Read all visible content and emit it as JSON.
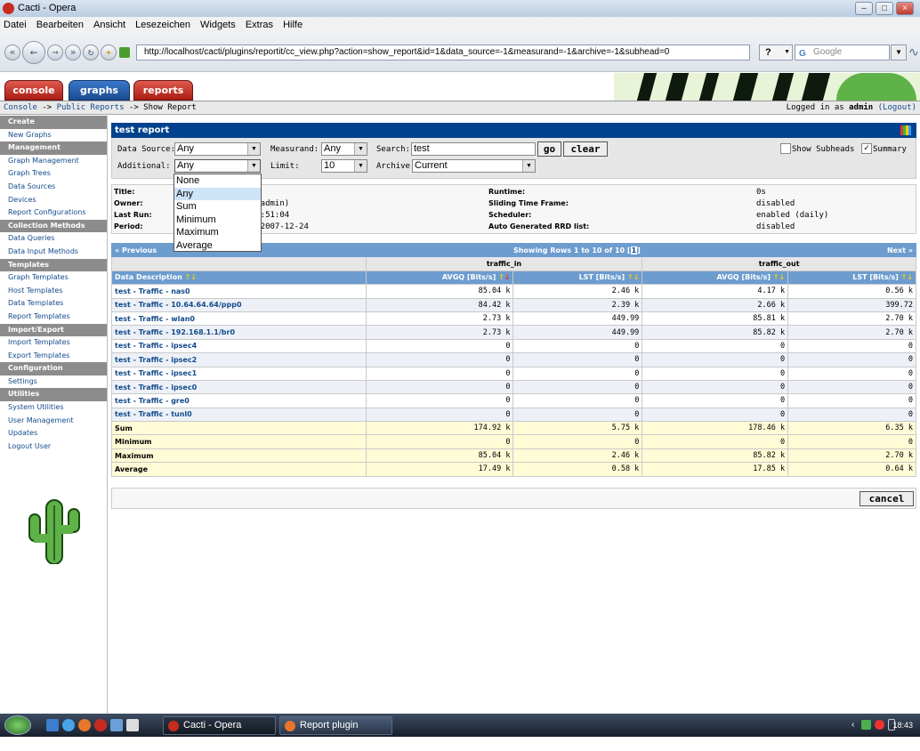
{
  "window": {
    "title": "Cacti - Opera"
  },
  "menubar": [
    "Datei",
    "Bearbeiten",
    "Ansicht",
    "Lesezeichen",
    "Widgets",
    "Extras",
    "Hilfe"
  ],
  "address": "http://localhost/cacti/plugins/reportit/cc_view.php?action=show_report&id=1&data_source=-1&measurand=-1&archive=-1&subhead=0",
  "help_label": "?",
  "search_placeholder": "Google",
  "tabs": {
    "console": "console",
    "graphs": "graphs",
    "reports": "reports"
  },
  "breadcrumb": {
    "console": "Console",
    "sep": "->",
    "public_reports": "Public Reports",
    "current": "Show Report"
  },
  "login": {
    "prefix": "Logged in as",
    "user": "admin",
    "logout": "(Logout)"
  },
  "sidebar": [
    {
      "type": "hd",
      "label": "Create"
    },
    {
      "type": "it",
      "label": "New Graphs"
    },
    {
      "type": "hd",
      "label": "Management"
    },
    {
      "type": "it",
      "label": "Graph Management"
    },
    {
      "type": "it",
      "label": "Graph Trees"
    },
    {
      "type": "it",
      "label": "Data Sources"
    },
    {
      "type": "it",
      "label": "Devices"
    },
    {
      "type": "it",
      "label": "Report Configurations"
    },
    {
      "type": "hd",
      "label": "Collection Methods"
    },
    {
      "type": "it",
      "label": "Data Queries"
    },
    {
      "type": "it",
      "label": "Data Input Methods"
    },
    {
      "type": "hd",
      "label": "Templates"
    },
    {
      "type": "it",
      "label": "Graph Templates"
    },
    {
      "type": "it",
      "label": "Host Templates"
    },
    {
      "type": "it",
      "label": "Data Templates"
    },
    {
      "type": "it",
      "label": "Report Templates"
    },
    {
      "type": "hd",
      "label": "Import/Export"
    },
    {
      "type": "it",
      "label": "Import Templates"
    },
    {
      "type": "it",
      "label": "Export Templates"
    },
    {
      "type": "hd",
      "label": "Configuration"
    },
    {
      "type": "it",
      "label": "Settings"
    },
    {
      "type": "hd",
      "label": "Utilities"
    },
    {
      "type": "it",
      "label": "System Utilities"
    },
    {
      "type": "it",
      "label": "User Management"
    },
    {
      "type": "it",
      "label": "Updates"
    },
    {
      "type": "it",
      "label": "Logout User"
    }
  ],
  "report": {
    "title": "test report"
  },
  "filter": {
    "data_source_label": "Data Source:",
    "data_source": "Any",
    "measurand_label": "Measurand:",
    "measurand": "Any",
    "search_label": "Search:",
    "search": "test",
    "go": "go",
    "clear": "clear",
    "show_subheads": "Show Subheads",
    "summary": "Summary",
    "additional_label": "Additional:",
    "additional": "Any",
    "limit_label": "Limit:",
    "limit": "10",
    "archive_label": "Archive:",
    "archive": "Current"
  },
  "dropdown_options": [
    "None",
    "Any",
    "Sum",
    "Minimum",
    "Maximum",
    "Average"
  ],
  "info": {
    "title_k": "Title:",
    "owner_k": "Owner:",
    "owner_v": "or (admin)",
    "lastrun_k": "Last Run:",
    "lastrun_v": "4 07:51:04",
    "period_k": "Period:",
    "period_v": "2 - 2007-12-24",
    "runtime_k": "Runtime:",
    "runtime_v": "0s",
    "sliding_k": "Sliding Time Frame:",
    "sliding_v": "disabled",
    "scheduler_k": "Scheduler:",
    "scheduler_v": "enabled (daily)",
    "autorrd_k": "Auto Generated RRD list:",
    "autorrd_v": "disabled"
  },
  "table": {
    "prev": "« Previous",
    "showing": "Showing Rows 1 to 10 of 10 [",
    "page": "1",
    "showing_end": "]",
    "next": "Next »",
    "group_in": "traffic_in",
    "group_out": "traffic_out",
    "col_desc": "Data Description",
    "col_avgq": "AVGQ [Bits/s]",
    "col_lst": "LST [Bits/s]",
    "rows": [
      [
        "test - Traffic - nas0",
        "85.04 k",
        "2.46 k",
        "4.17 k",
        "0.56 k"
      ],
      [
        "test - Traffic - 10.64.64.64/ppp0",
        "84.42 k",
        "2.39 k",
        "2.66 k",
        "399.72"
      ],
      [
        "test - Traffic - wlan0",
        "2.73 k",
        "449.99",
        "85.81 k",
        "2.70 k"
      ],
      [
        "test - Traffic - 192.168.1.1/br0",
        "2.73 k",
        "449.99",
        "85.82 k",
        "2.70 k"
      ],
      [
        "test - Traffic - ipsec4",
        "0",
        "0",
        "0",
        "0"
      ],
      [
        "test - Traffic - ipsec2",
        "0",
        "0",
        "0",
        "0"
      ],
      [
        "test - Traffic - ipsec1",
        "0",
        "0",
        "0",
        "0"
      ],
      [
        "test - Traffic - ipsec0",
        "0",
        "0",
        "0",
        "0"
      ],
      [
        "test - Traffic - gre0",
        "0",
        "0",
        "0",
        "0"
      ],
      [
        "test - Traffic - tunl0",
        "0",
        "0",
        "0",
        "0"
      ]
    ],
    "summary": [
      [
        "Sum",
        "174.92 k",
        "5.75 k",
        "178.46 k",
        "6.35 k"
      ],
      [
        "Minimum",
        "0",
        "0",
        "0",
        "0"
      ],
      [
        "Maximum",
        "85.04 k",
        "2.46 k",
        "85.82 k",
        "2.70 k"
      ],
      [
        "Average",
        "17.49 k",
        "0.58 k",
        "17.85 k",
        "0.64 k"
      ]
    ]
  },
  "cancel": "cancel",
  "taskbar": {
    "task1": "Cacti - Opera",
    "task2": "Report plugin \"Repo...",
    "clock": "18:43"
  },
  "colors": {
    "header_blue": "#00438c",
    "table_blue": "#6d9ccf",
    "summary_yellow": "#fffbd6",
    "tab_red": "#a81d14"
  }
}
